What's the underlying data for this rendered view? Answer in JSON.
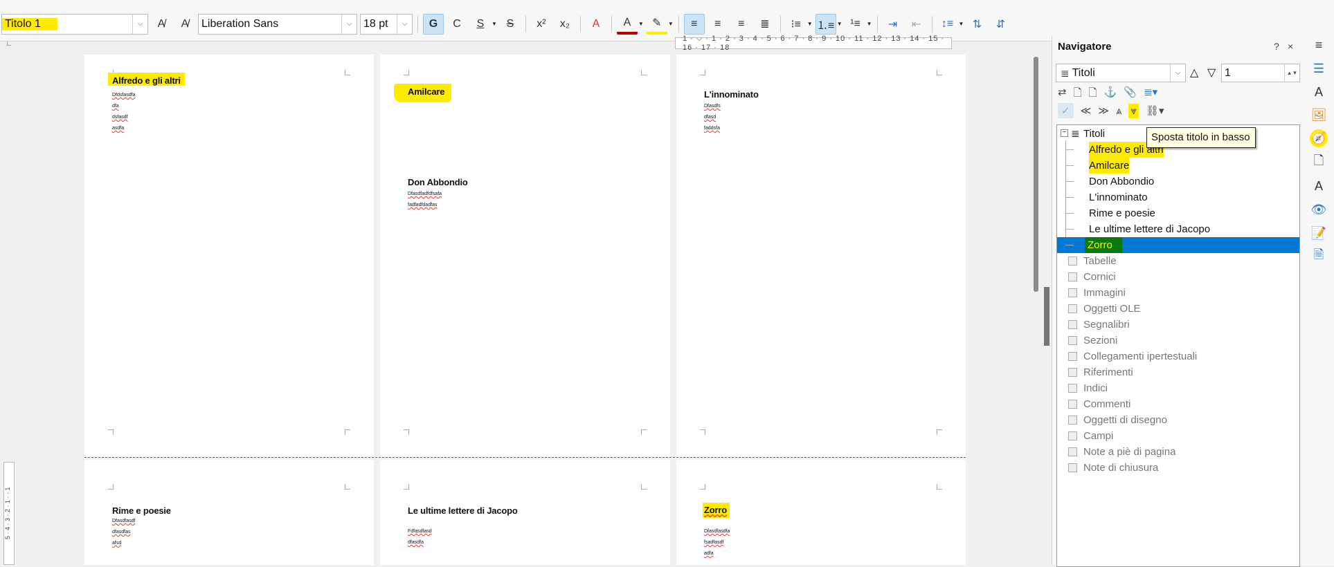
{
  "toolbar": {
    "paragraph_style": "Titolo 1",
    "font_name": "Liberation Sans",
    "font_size": "18 pt",
    "bold_label": "G",
    "italic_label": "C",
    "underline_label": "S",
    "strike_label": "S",
    "superscript_label": "x²",
    "subscript_label": "x₂",
    "font_color": "#c00000",
    "highlight_color": "#ffeb00"
  },
  "ruler": {
    "ticks": "1 · ⌵ · 1 · 2 · 3 · 4 · 5 · 6 · 7 · 8 · 9 · 10 · 11 · 12 · 13 · 14 · 15 · 16 · 17 · 18"
  },
  "vruler": {
    "ticks": "5 · 4 · 3 · 2 · 1 · · 1"
  },
  "pages": [
    {
      "heading": "Alfredo e gli altri",
      "lines": [
        "Dfdsfasdfa",
        "dfa",
        "dsfasdf",
        "asdfa"
      ]
    },
    {
      "heading": "Amilcare",
      "lines": []
    },
    {
      "heading": "Don Abbondio",
      "lines": [
        "Dfasdfadfdfsafa",
        "fadfadfdadfas"
      ]
    },
    {
      "heading": "L'innominato",
      "lines": [
        "Dfasdfs",
        "dfasd",
        "faddsfa"
      ]
    },
    {
      "heading": "Rime e poesie",
      "lines": [
        "Dfasdfasdf",
        "dfasdfas",
        "afsd"
      ]
    },
    {
      "heading": "Le ultime lettere di Jacopo",
      "lines": [
        "Fdfasdfasd",
        "dfasdfa"
      ]
    },
    {
      "heading": "Zorro",
      "lines": [
        "Dfasdfasdfa",
        "fsadfasdf",
        "adfa"
      ]
    }
  ],
  "navigator": {
    "title": "Navigatore",
    "help": "?",
    "close": "×",
    "category_select": "Titoli",
    "level_value": "1",
    "tooltip": "Sposta titolo in basso",
    "root": "Titoli",
    "headings": [
      "Alfredo e gli altri",
      "Amilcare",
      "Don Abbondio",
      "L'innominato",
      "Rime e poesie",
      "Le ultime lettere di Jacopo",
      "Zorro"
    ],
    "selected": "Zorro",
    "categories": [
      "Tabelle",
      "Cornici",
      "Immagini",
      "Oggetti OLE",
      "Segnalibri",
      "Sezioni",
      "Collegamenti ipertestuali",
      "Riferimenti",
      "Indici",
      "Commenti",
      "Oggetti di disegno",
      "Campi",
      "Note a piè di pagina",
      "Note di chiusura"
    ]
  },
  "colors": {
    "accent": "#0078d4",
    "highlight": "#ffeb00",
    "selection_text": "#ffeb00"
  }
}
